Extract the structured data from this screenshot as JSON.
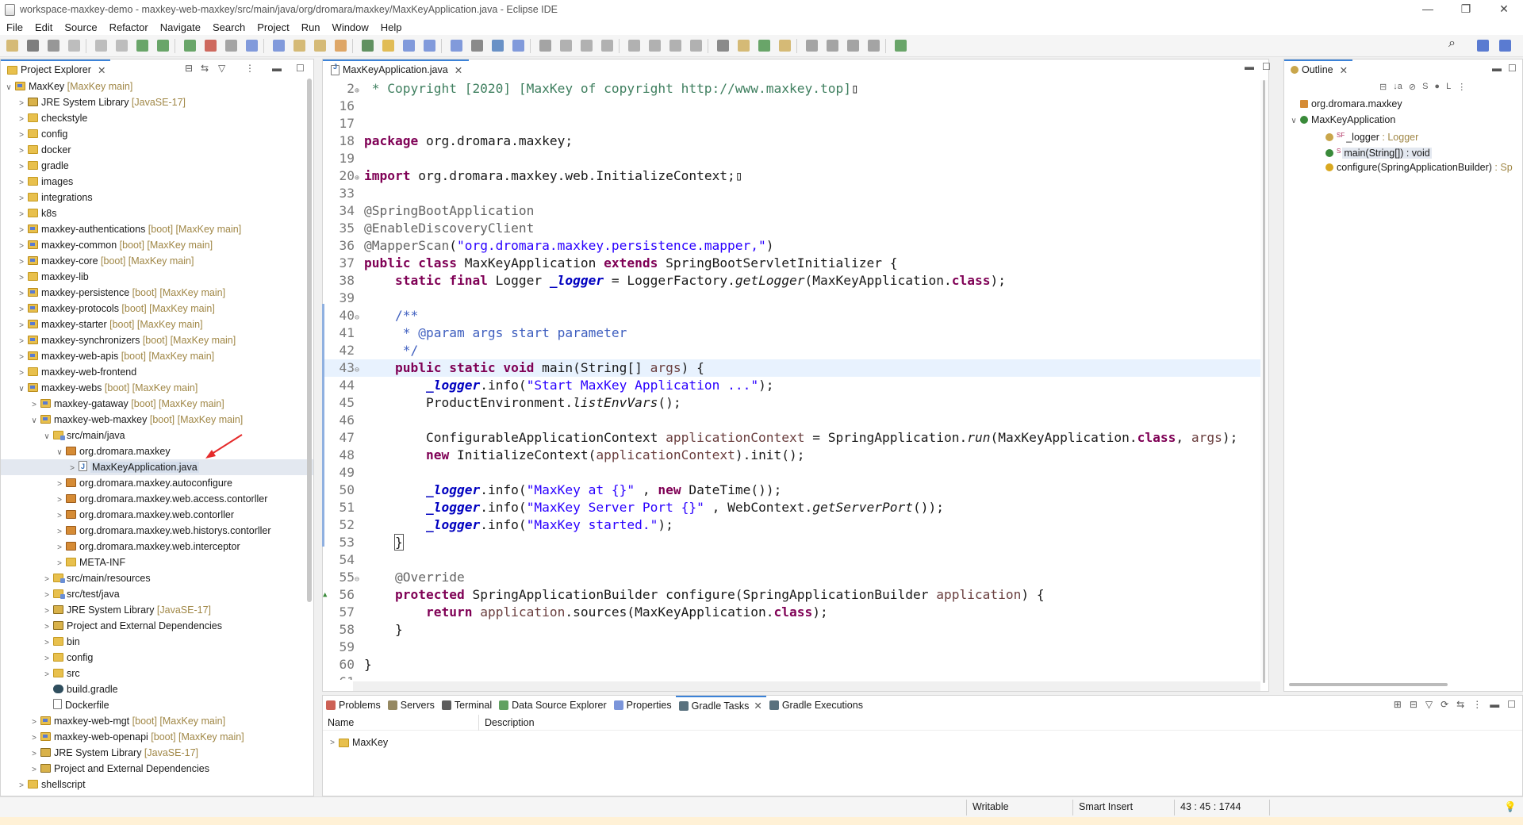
{
  "window": {
    "title": "workspace-maxkey-demo - maxkey-web-maxkey/src/main/java/org/dromara/maxkey/MaxKeyApplication.java - Eclipse IDE",
    "minimize": "—",
    "maximize": "❐",
    "close": "✕"
  },
  "menu": [
    "File",
    "Edit",
    "Source",
    "Refactor",
    "Navigate",
    "Search",
    "Project",
    "Run",
    "Window",
    "Help"
  ],
  "project_explorer": {
    "title": "Project Explorer",
    "items": [
      {
        "chev": "∨",
        "icon": "project",
        "label": "MaxKey",
        "dec": " [MaxKey main]",
        "indent": 0
      },
      {
        "chev": ">",
        "icon": "lib",
        "label": "JRE System Library",
        "dec": " [JavaSE-17]",
        "indent": 1
      },
      {
        "chev": ">",
        "icon": "folder",
        "label": "checkstyle",
        "dec": "",
        "indent": 1
      },
      {
        "chev": ">",
        "icon": "folder",
        "label": "config",
        "dec": "",
        "indent": 1
      },
      {
        "chev": ">",
        "icon": "folder",
        "label": "docker",
        "dec": "",
        "indent": 1
      },
      {
        "chev": ">",
        "icon": "folder",
        "label": "gradle",
        "dec": "",
        "indent": 1
      },
      {
        "chev": ">",
        "icon": "folder",
        "label": "images",
        "dec": "",
        "indent": 1
      },
      {
        "chev": ">",
        "icon": "folder",
        "label": "integrations",
        "dec": "",
        "indent": 1
      },
      {
        "chev": ">",
        "icon": "folder",
        "label": "k8s",
        "dec": "",
        "indent": 1
      },
      {
        "chev": ">",
        "icon": "project",
        "label": "maxkey-authentications",
        "dec": " [boot] [MaxKey main]",
        "indent": 1
      },
      {
        "chev": ">",
        "icon": "project",
        "label": "maxkey-common",
        "dec": " [boot] [MaxKey main]",
        "indent": 1
      },
      {
        "chev": ">",
        "icon": "project",
        "label": "maxkey-core",
        "dec": " [boot] [MaxKey main]",
        "indent": 1
      },
      {
        "chev": ">",
        "icon": "folder",
        "label": "maxkey-lib",
        "dec": "",
        "indent": 1
      },
      {
        "chev": ">",
        "icon": "project",
        "label": "maxkey-persistence",
        "dec": " [boot] [MaxKey main]",
        "indent": 1
      },
      {
        "chev": ">",
        "icon": "project",
        "label": "maxkey-protocols",
        "dec": " [boot] [MaxKey main]",
        "indent": 1
      },
      {
        "chev": ">",
        "icon": "project",
        "label": "maxkey-starter",
        "dec": " [boot] [MaxKey main]",
        "indent": 1
      },
      {
        "chev": ">",
        "icon": "project",
        "label": "maxkey-synchronizers",
        "dec": " [boot] [MaxKey main]",
        "indent": 1
      },
      {
        "chev": ">",
        "icon": "project",
        "label": "maxkey-web-apis",
        "dec": " [boot] [MaxKey main]",
        "indent": 1
      },
      {
        "chev": ">",
        "icon": "folder",
        "label": "maxkey-web-frontend",
        "dec": "",
        "indent": 1
      },
      {
        "chev": "∨",
        "icon": "project",
        "label": "maxkey-webs",
        "dec": " [boot] [MaxKey main]",
        "indent": 1
      },
      {
        "chev": ">",
        "icon": "project",
        "label": "maxkey-gataway",
        "dec": " [boot] [MaxKey main]",
        "indent": 2
      },
      {
        "chev": "∨",
        "icon": "project",
        "label": "maxkey-web-maxkey",
        "dec": " [boot] [MaxKey main]",
        "indent": 2
      },
      {
        "chev": "∨",
        "icon": "src",
        "label": "src/main/java",
        "dec": "",
        "indent": 3
      },
      {
        "chev": "∨",
        "icon": "pkg",
        "label": "org.dromara.maxkey",
        "dec": "",
        "indent": 4
      },
      {
        "chev": ">",
        "icon": "java",
        "label": "MaxKeyApplication.java",
        "dec": "",
        "indent": 5,
        "selected": true
      },
      {
        "chev": ">",
        "icon": "pkg",
        "label": "org.dromara.maxkey.autoconfigure",
        "dec": "",
        "indent": 4
      },
      {
        "chev": ">",
        "icon": "pkg",
        "label": "org.dromara.maxkey.web.access.contorller",
        "dec": "",
        "indent": 4
      },
      {
        "chev": ">",
        "icon": "pkg",
        "label": "org.dromara.maxkey.web.contorller",
        "dec": "",
        "indent": 4
      },
      {
        "chev": ">",
        "icon": "pkg",
        "label": "org.dromara.maxkey.web.historys.contorller",
        "dec": "",
        "indent": 4
      },
      {
        "chev": ">",
        "icon": "pkg",
        "label": "org.dromara.maxkey.web.interceptor",
        "dec": "",
        "indent": 4
      },
      {
        "chev": ">",
        "icon": "folder",
        "label": "META-INF",
        "dec": "",
        "indent": 4
      },
      {
        "chev": ">",
        "icon": "src",
        "label": "src/main/resources",
        "dec": "",
        "indent": 3
      },
      {
        "chev": ">",
        "icon": "src",
        "label": "src/test/java",
        "dec": "",
        "indent": 3
      },
      {
        "chev": ">",
        "icon": "lib",
        "label": "JRE System Library",
        "dec": " [JavaSE-17]",
        "indent": 3
      },
      {
        "chev": ">",
        "icon": "lib",
        "label": "Project and External Dependencies",
        "dec": "",
        "indent": 3
      },
      {
        "chev": ">",
        "icon": "folder",
        "label": "bin",
        "dec": "",
        "indent": 3
      },
      {
        "chev": ">",
        "icon": "folder",
        "label": "config",
        "dec": "",
        "indent": 3
      },
      {
        "chev": ">",
        "icon": "folder",
        "label": "src",
        "dec": "",
        "indent": 3
      },
      {
        "chev": "",
        "icon": "gradle",
        "label": "build.gradle",
        "dec": "",
        "indent": 3
      },
      {
        "chev": "",
        "icon": "docker",
        "label": "Dockerfile",
        "dec": "",
        "indent": 3
      },
      {
        "chev": ">",
        "icon": "project",
        "label": "maxkey-web-mgt",
        "dec": " [boot] [MaxKey main]",
        "indent": 2
      },
      {
        "chev": ">",
        "icon": "project",
        "label": "maxkey-web-openapi",
        "dec": " [boot] [MaxKey main]",
        "indent": 2
      },
      {
        "chev": ">",
        "icon": "lib",
        "label": "JRE System Library",
        "dec": " [JavaSE-17]",
        "indent": 2
      },
      {
        "chev": ">",
        "icon": "lib",
        "label": "Project and External Dependencies",
        "dec": "",
        "indent": 2
      },
      {
        "chev": ">",
        "icon": "folder",
        "label": "shellscript",
        "dec": "",
        "indent": 1
      }
    ]
  },
  "editor": {
    "tab": "MaxKeyApplication.java",
    "lines": [
      {
        "n": "2",
        "f": "⊕",
        "h": "<span class='cgr'> * Copyright [2020] [MaxKey of copyright http://www.maxkey.top]</span>▯"
      },
      {
        "n": "16",
        "f": "",
        "h": ""
      },
      {
        "n": "17",
        "f": "",
        "h": ""
      },
      {
        "n": "18",
        "f": "",
        "h": "<span class='kw'>package</span> org.dromara.maxkey;"
      },
      {
        "n": "19",
        "f": "",
        "h": ""
      },
      {
        "n": "20",
        "f": "⊕",
        "h": "<span class='kw'>import</span> org.dromara.maxkey.web.InitializeContext;▯"
      },
      {
        "n": "33",
        "f": "",
        "h": ""
      },
      {
        "n": "34",
        "f": "",
        "h": "<span class='ann'>@SpringBootApplication</span>"
      },
      {
        "n": "35",
        "f": "",
        "h": "<span class='ann'>@EnableDiscoveryClient</span>"
      },
      {
        "n": "36",
        "f": "",
        "h": "<span class='ann'>@MapperScan</span>(<span class='str'>\"org.dromara.maxkey.persistence.mapper,\"</span>)"
      },
      {
        "n": "37",
        "f": "",
        "h": "<span class='kw'>public class</span> MaxKeyApplication <span class='kw'>extends</span> SpringBootServletInitializer {"
      },
      {
        "n": "38",
        "f": "",
        "h": "    <span class='kw'>static final</span> Logger <span class='fld'>_logger</span> = LoggerFactory.<span class='ital'>getLogger</span>(MaxKeyApplication.<span class='kw'>class</span>);"
      },
      {
        "n": "39",
        "f": "",
        "h": ""
      },
      {
        "n": "40",
        "f": "⊖",
        "h": "    <span class='cm'>/**</span>"
      },
      {
        "n": "41",
        "f": "",
        "h": "<span class='cm'>     * @param args start parameter</span>"
      },
      {
        "n": "42",
        "f": "",
        "h": "<span class='cm'>     */</span>"
      },
      {
        "n": "43",
        "f": "⊖",
        "h": "    <span class='kw'>public static void</span> main(String[] <span class='var'>args</span>) {",
        "cur": true
      },
      {
        "n": "44",
        "f": "",
        "h": "        <span class='fld'>_logger</span>.info(<span class='str'>\"Start MaxKey Application ...\"</span>);"
      },
      {
        "n": "45",
        "f": "",
        "h": "        ProductEnvironment.<span class='ital'>listEnvVars</span>();"
      },
      {
        "n": "46",
        "f": "",
        "h": ""
      },
      {
        "n": "47",
        "f": "",
        "h": "        ConfigurableApplicationContext <span class='var'>applicationContext</span> = SpringApplication.<span class='ital'>run</span>(MaxKeyApplication.<span class='kw'>class</span>, <span class='var'>args</span>);"
      },
      {
        "n": "48",
        "f": "",
        "h": "        <span class='kw'>new</span> InitializeContext(<span class='var'>applicationContext</span>).init();"
      },
      {
        "n": "49",
        "f": "",
        "h": ""
      },
      {
        "n": "50",
        "f": "",
        "h": "        <span class='fld'>_logger</span>.info(<span class='str'>\"MaxKey at {}\"</span> , <span class='kw'>new</span> DateTime());"
      },
      {
        "n": "51",
        "f": "",
        "h": "        <span class='fld'>_logger</span>.info(<span class='str'>\"MaxKey Server Port {}\"</span> , WebContext.<span class='ital'>getServerPort</span>());"
      },
      {
        "n": "52",
        "f": "",
        "h": "        <span class='fld'>_logger</span>.info(<span class='str'>\"MaxKey started.\"</span>);"
      },
      {
        "n": "53",
        "f": "",
        "h": "    <span style='outline:1px solid #555'>}</span>"
      },
      {
        "n": "54",
        "f": "",
        "h": ""
      },
      {
        "n": "55",
        "f": "⊖",
        "h": "    <span class='ann'>@Override</span>"
      },
      {
        "n": "56",
        "f": "",
        "h": "    <span class='kw'>protected</span> SpringApplicationBuilder configure(SpringApplicationBuilder <span class='var'>application</span>) {",
        "mk": "▲"
      },
      {
        "n": "57",
        "f": "",
        "h": "        <span class='kw'>return</span> <span class='var'>application</span>.sources(MaxKeyApplication.<span class='kw'>class</span>);"
      },
      {
        "n": "58",
        "f": "",
        "h": "    }"
      },
      {
        "n": "59",
        "f": "",
        "h": ""
      },
      {
        "n": "60",
        "f": "",
        "h": "}"
      },
      {
        "n": "61",
        "f": "",
        "h": ""
      }
    ]
  },
  "outline": {
    "title": "Outline",
    "items": [
      {
        "label": "org.dromara.maxkey",
        "type": "",
        "indent": 1,
        "icon": "pkg"
      },
      {
        "label": "MaxKeyApplication",
        "type": "",
        "indent": 1,
        "icon": "class",
        "chev": "∨"
      },
      {
        "label": "_logger",
        "type": " : Logger",
        "indent": 2,
        "icon": "field",
        "pre": "SF"
      },
      {
        "label": "main(String[]) : void",
        "type": "",
        "indent": 2,
        "icon": "method",
        "pre": "S",
        "selected": true
      },
      {
        "label": "configure(SpringApplicationBuilder)",
        "type": " : Sp",
        "indent": 2,
        "icon": "protected"
      }
    ]
  },
  "bottom": {
    "tabs": [
      {
        "label": "Problems",
        "color": "#c0392b"
      },
      {
        "label": "Servers",
        "color": "#7a6a3a"
      },
      {
        "label": "Terminal",
        "color": "#333"
      },
      {
        "label": "Data Source Explorer",
        "color": "#3a8a3a"
      },
      {
        "label": "Properties",
        "color": "#5a7bd1"
      },
      {
        "label": "Gradle Tasks",
        "color": "#2f4e5e",
        "active": true,
        "close": "✕"
      },
      {
        "label": "Gradle Executions",
        "color": "#2f4e5e"
      }
    ],
    "col_name": "Name",
    "col_desc": "Description",
    "row": "MaxKey"
  },
  "status": {
    "writable": "Writable",
    "insert": "Smart Insert",
    "position": "43 : 45 : 1744"
  }
}
